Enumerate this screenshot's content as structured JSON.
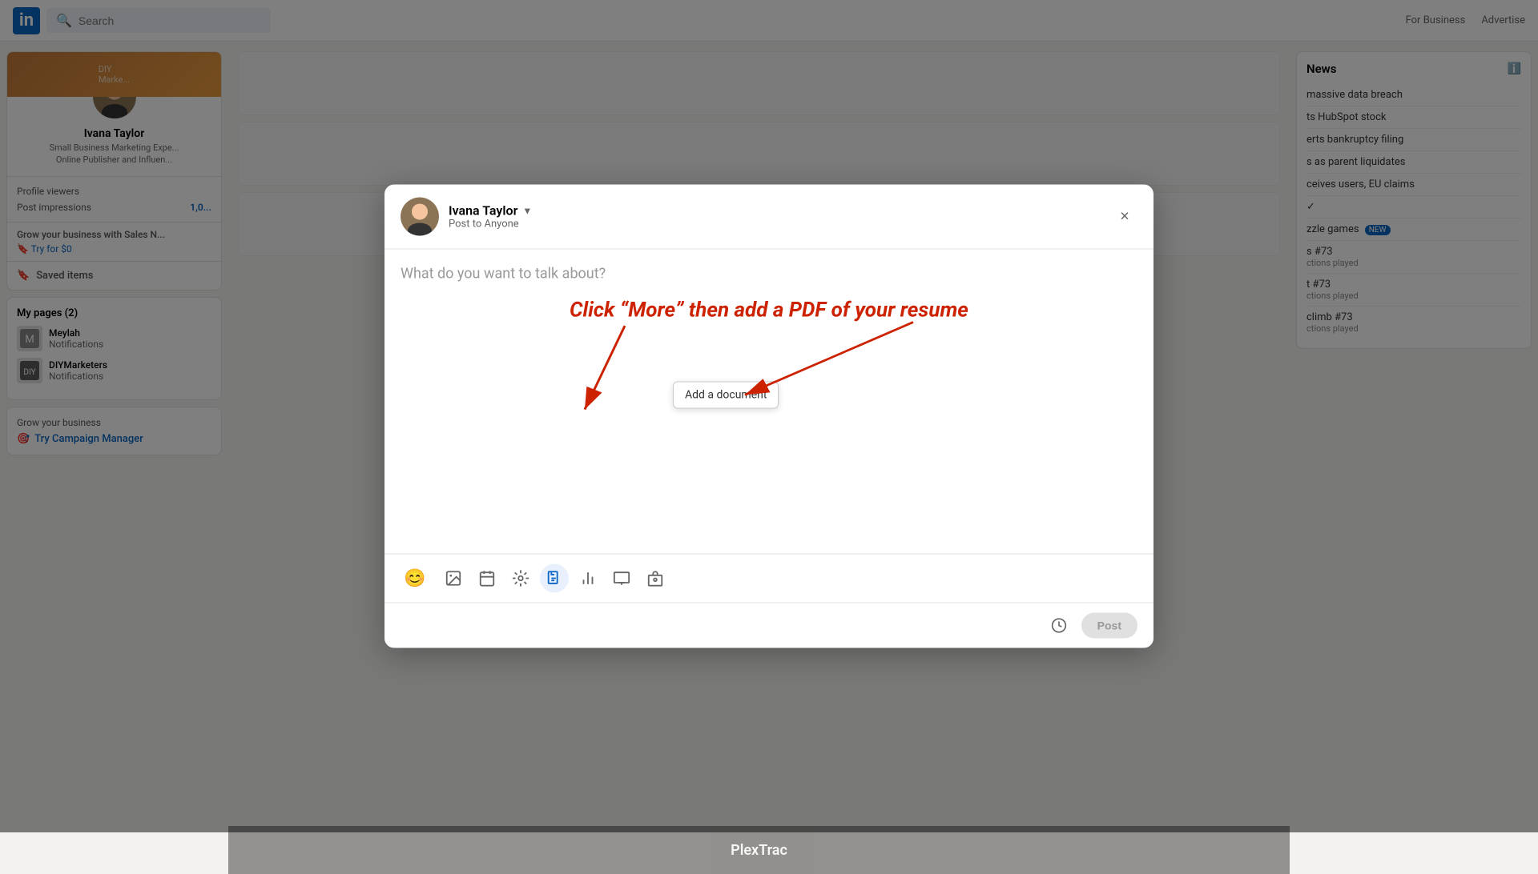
{
  "topnav": {
    "logo_text": "in",
    "search_placeholder": "Search",
    "right_items": [
      "For Business",
      "Advertise"
    ]
  },
  "sidebar": {
    "profile": {
      "name": "Ivana Taylor",
      "title_line1": "Small Business Marketing Expe...",
      "title_line2": "Online Publisher and Influen...",
      "stat_viewers_label": "Profile viewers",
      "stat_impressions_label": "Post impressions",
      "stat_impressions_val": "1,0...",
      "promo_title": "Grow your business with Sales N...",
      "promo_link": "🔖 Try for $0",
      "saved_items": "Saved items"
    },
    "my_pages_title": "My pages (2)",
    "pages": [
      {
        "name": "Meylah",
        "sub": "Notifications"
      },
      {
        "name": "DIYMarketers",
        "sub": "Notifications"
      }
    ],
    "grow_title": "Grow your business",
    "grow_link": "Try Campaign Manager"
  },
  "news": {
    "title": "News",
    "items": [
      {
        "text": "massive data breach",
        "sub": ""
      },
      {
        "text": "ts HubSpot stock",
        "sub": ""
      },
      {
        "text": "erts bankruptcy filing",
        "sub": ""
      },
      {
        "text": "s as parent liquidates",
        "sub": ""
      },
      {
        "text": "ceives users, EU claims",
        "sub": ""
      },
      {
        "text": "✓",
        "sub": ""
      },
      {
        "text": "zzle games",
        "badge": "NEW",
        "sub": ""
      },
      {
        "text": "s #73",
        "sub": "ctions played"
      },
      {
        "text": "t #73",
        "sub": "ctions played"
      },
      {
        "text": "climb #73",
        "sub": "ctions played"
      }
    ]
  },
  "modal": {
    "user_name": "Ivana Taylor",
    "audience": "Post to Anyone",
    "placeholder": "What do you want to talk about?",
    "annotation": "Click “More” then add a PDF of your resume",
    "tooltip": "Add a document",
    "post_button": "Post",
    "toolbar_icons": [
      "photo",
      "calendar",
      "celebrate",
      "document",
      "chart",
      "slide",
      "job"
    ],
    "close_label": "×"
  },
  "bottom_banner": {
    "text": "PlexTrac"
  }
}
